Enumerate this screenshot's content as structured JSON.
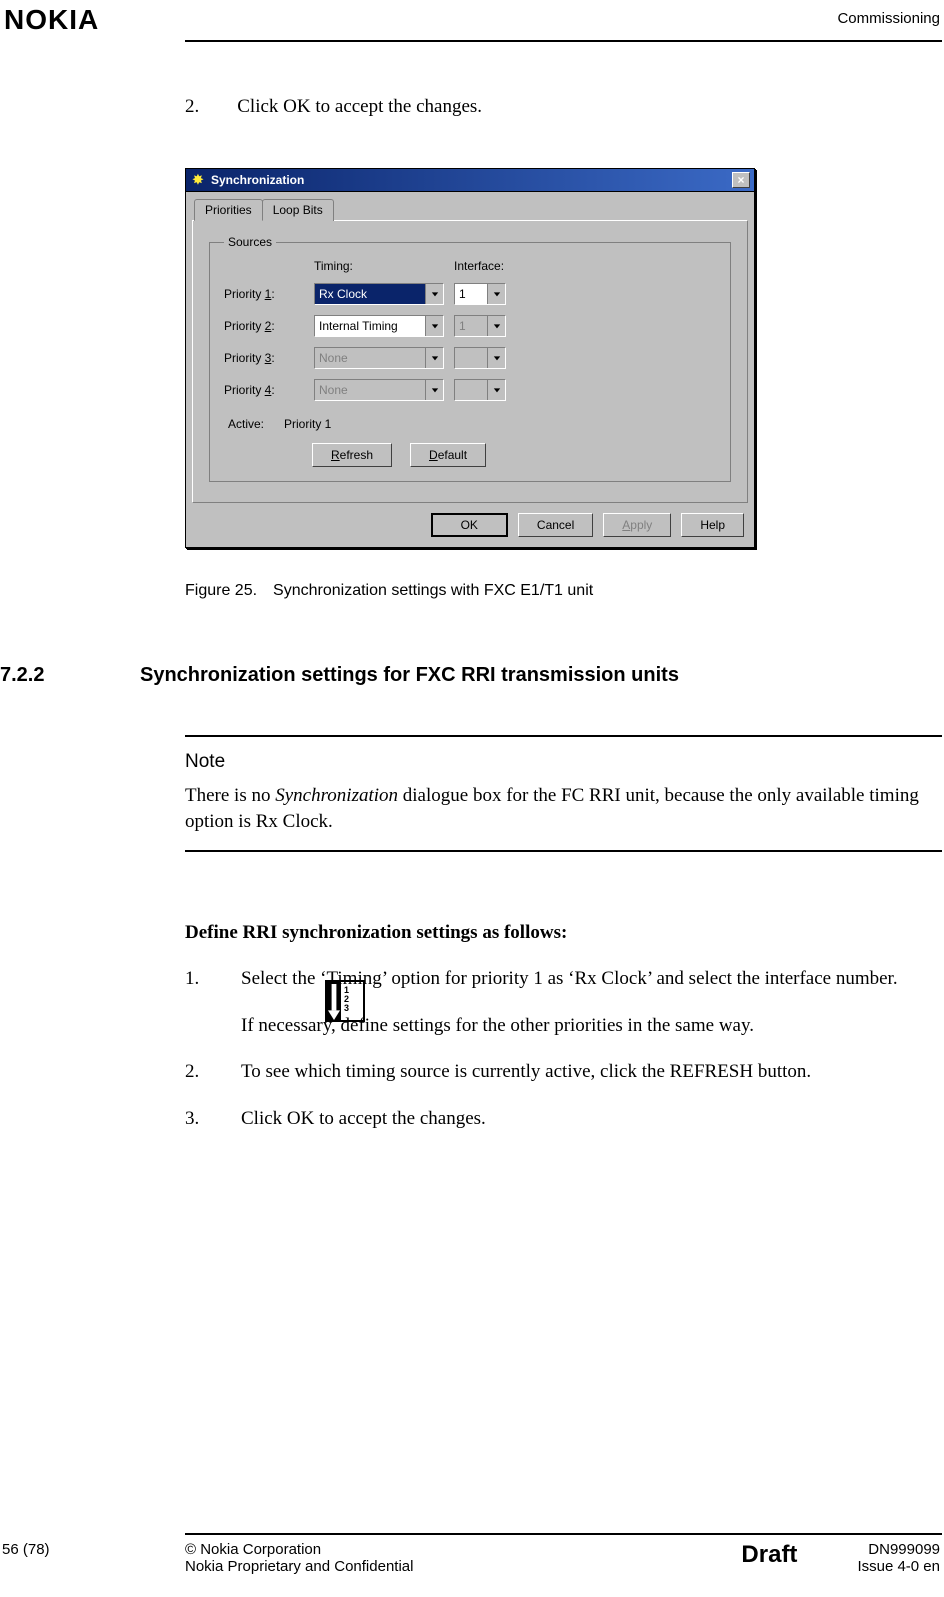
{
  "header": {
    "logo": "NOKIA",
    "section": "Commissioning"
  },
  "body": {
    "step2": {
      "num": "2.",
      "text": "Click OK to accept the changes."
    }
  },
  "dialog": {
    "title": "Synchronization",
    "tabs": {
      "priorities": "Priorities",
      "loopbits": "Loop Bits"
    },
    "group_legend": "Sources",
    "col_timing": "Timing:",
    "col_iface": "Interface:",
    "rows": {
      "p1": {
        "label_pre": "Priority ",
        "hot": "1",
        "label_post": ":",
        "timing": "Rx Clock",
        "iface": "1"
      },
      "p2": {
        "label_pre": "Priority ",
        "hot": "2",
        "label_post": ":",
        "timing": "Internal Timing",
        "iface": "1"
      },
      "p3": {
        "label_pre": "Priority ",
        "hot": "3",
        "label_post": ":",
        "timing": "None",
        "iface": ""
      },
      "p4": {
        "label_pre": "Priority ",
        "hot": "4",
        "label_post": ":",
        "timing": "None",
        "iface": ""
      }
    },
    "active_label": "Active:",
    "active_value": "Priority 1",
    "btn_refresh_hot": "R",
    "btn_refresh_rest": "efresh",
    "btn_default_hot": "D",
    "btn_default_rest": "efault",
    "btn_ok": "OK",
    "btn_cancel": "Cancel",
    "btn_apply_hot": "A",
    "btn_apply_rest": "pply",
    "btn_help": "Help"
  },
  "caption": "Figure 25. Synchronization settings with FXC E1/T1 unit",
  "section": {
    "num": "7.2.2",
    "title": "Synchronization settings for FXC RRI transmission units"
  },
  "note": {
    "head": "Note",
    "pre": "There is no ",
    "ital": "Synchronization",
    "post": " dialogue box for the FC RRI unit, because the only available timing option is Rx Clock."
  },
  "task": {
    "title": "Define RRI synchronization settings as follows:",
    "s1": {
      "num": "1.",
      "text": "Select the ‘Timing’ option for priority 1 as ‘Rx Clock’ and select the interface number."
    },
    "s1b": "If necessary, define settings for the other priorities in the same way.",
    "s2": {
      "num": "2.",
      "text": "To see which timing source is currently active, click the REFRESH button."
    },
    "s3": {
      "num": "3.",
      "text": "Click OK to accept the changes."
    }
  },
  "footer": {
    "page": "56 (78)",
    "copyright": "© Nokia Corporation",
    "proprietary": "Nokia Proprietary and Confidential",
    "draft": "Draft",
    "docnum": "DN999099",
    "issue": "Issue 4-0 en"
  }
}
